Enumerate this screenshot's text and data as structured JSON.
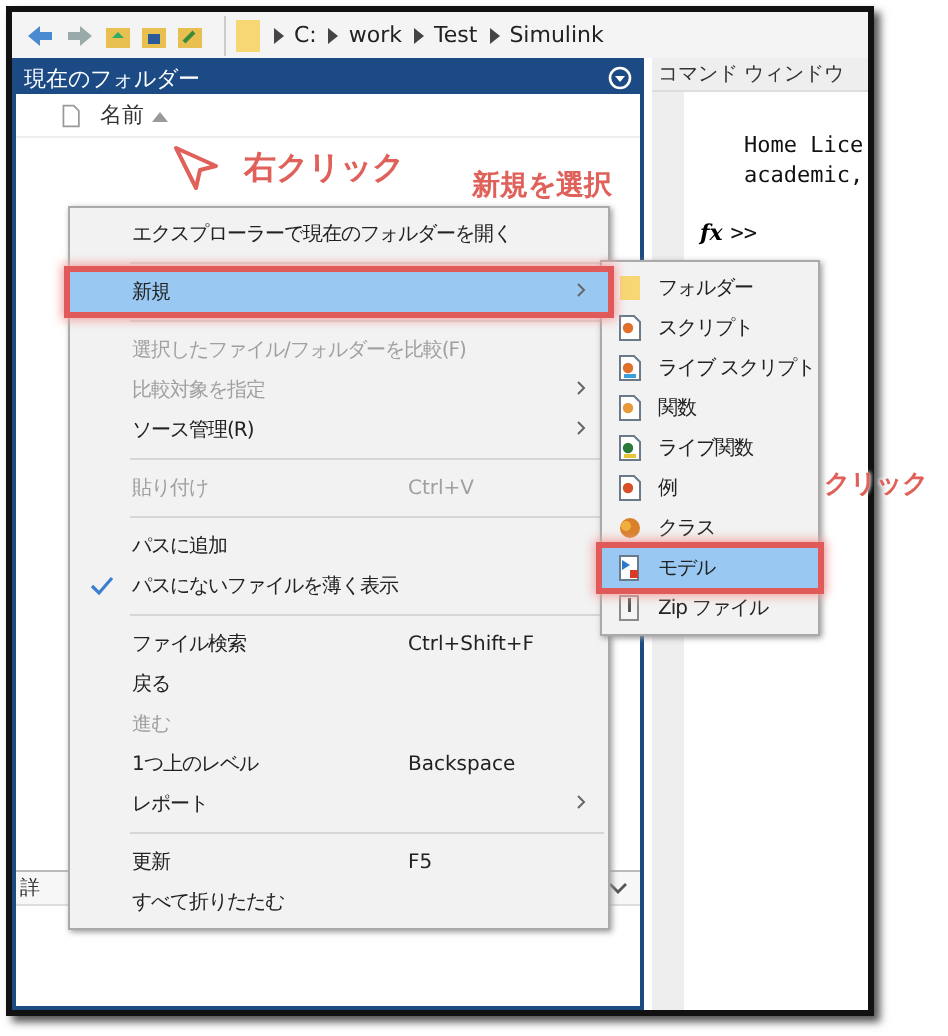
{
  "toolbar": {
    "path": [
      "C:",
      "work",
      "Test",
      "Simulink"
    ]
  },
  "current_folder": {
    "title": "現在のフォルダー",
    "column": "名前",
    "details_label": "詳"
  },
  "command_window": {
    "title": "コマンド ウィンドウ",
    "lines": [
      "Home Lice",
      "academic,"
    ],
    "fx_label": "fx",
    "prompt": ">>"
  },
  "context_menu": {
    "groups": [
      [
        {
          "label": "エクスプローラーで現在のフォルダーを開く",
          "disabled": false,
          "selected": false,
          "checked": false,
          "submenu": false
        }
      ],
      [
        {
          "label": "新規",
          "disabled": false,
          "selected": true,
          "checked": false,
          "submenu": true
        }
      ],
      [
        {
          "label": "選択したファイル/フォルダーを比較(F)",
          "disabled": true,
          "selected": false,
          "checked": false,
          "submenu": false
        },
        {
          "label": "比較対象を指定",
          "disabled": true,
          "selected": false,
          "checked": false,
          "submenu": true
        },
        {
          "label": "ソース管理(R)",
          "disabled": false,
          "selected": false,
          "checked": false,
          "submenu": true
        }
      ],
      [
        {
          "label": "貼り付け",
          "shortcut": "Ctrl+V",
          "disabled": true,
          "selected": false,
          "checked": false,
          "submenu": false
        }
      ],
      [
        {
          "label": "パスに追加",
          "disabled": false,
          "selected": false,
          "checked": false,
          "submenu": false
        },
        {
          "label": "パスにないファイルを薄く表示",
          "disabled": false,
          "selected": false,
          "checked": true,
          "submenu": false
        }
      ],
      [
        {
          "label": "ファイル検索",
          "shortcut": "Ctrl+Shift+F",
          "disabled": false,
          "selected": false,
          "checked": false,
          "submenu": false
        },
        {
          "label": "戻る",
          "disabled": false,
          "selected": false,
          "checked": false,
          "submenu": false
        },
        {
          "label": "進む",
          "disabled": true,
          "selected": false,
          "checked": false,
          "submenu": false
        },
        {
          "label": "1つ上のレベル",
          "shortcut": "Backspace",
          "disabled": false,
          "selected": false,
          "checked": false,
          "submenu": false
        },
        {
          "label": "レポート",
          "disabled": false,
          "selected": false,
          "checked": false,
          "submenu": true
        }
      ],
      [
        {
          "label": "更新",
          "shortcut": "F5",
          "disabled": false,
          "selected": false,
          "checked": false,
          "submenu": false
        },
        {
          "label": "すべて折りたたむ",
          "disabled": false,
          "selected": false,
          "checked": false,
          "submenu": false
        }
      ]
    ]
  },
  "submenu": {
    "items": [
      {
        "label": "フォルダー",
        "kind": "folder",
        "selected": false
      },
      {
        "label": "スクリプト",
        "kind": "script",
        "selected": false
      },
      {
        "label": "ライブ スクリプト",
        "kind": "live-script",
        "selected": false
      },
      {
        "label": "関数",
        "kind": "function",
        "selected": false
      },
      {
        "label": "ライブ関数",
        "kind": "live-function",
        "selected": false
      },
      {
        "label": "例",
        "kind": "example",
        "selected": false
      },
      {
        "label": "クラス",
        "kind": "class",
        "selected": false
      },
      {
        "label": "モデル",
        "kind": "model",
        "selected": true
      },
      {
        "label": "Zip ファイル",
        "kind": "zip",
        "selected": false
      }
    ]
  },
  "annotations": [
    {
      "text": "右クリック",
      "kind": "cursor"
    },
    {
      "text": "新規を選択",
      "kind": "plain"
    },
    {
      "text": "クリック",
      "kind": "plain"
    }
  ]
}
